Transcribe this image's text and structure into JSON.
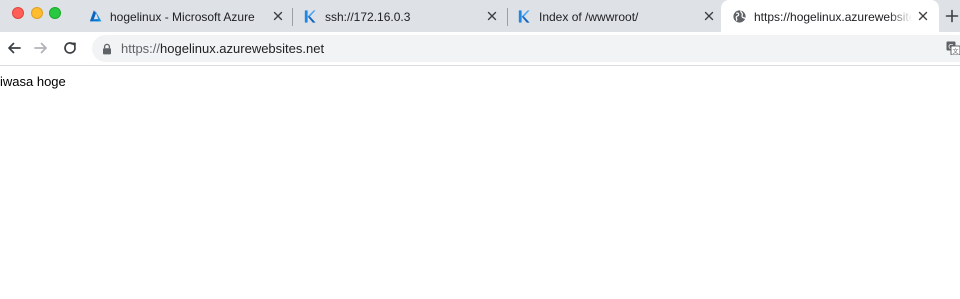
{
  "window": {
    "controls": [
      "close",
      "minimize",
      "zoom"
    ]
  },
  "tabs": [
    {
      "title": "hogelinux - Microsoft Azure",
      "icon": "azure-icon",
      "active": false
    },
    {
      "title": "ssh://172.16.0.3",
      "icon": "kudu-icon",
      "active": false
    },
    {
      "title": "Index of /wwwroot/",
      "icon": "kudu-icon",
      "active": false
    },
    {
      "title": "https://hogelinux.azurewebsites.net",
      "icon": "globe-icon",
      "active": true
    }
  ],
  "toolbar": {
    "url_scheme": "https://",
    "url_host": "hogelinux.azurewebsites.net"
  },
  "page": {
    "body_text": "iwasa hoge"
  },
  "colors": {
    "tabstrip_bg": "#dee1e6",
    "omnibox_bg": "#f1f3f4",
    "azure_blue": "#0078d4",
    "kudu_blue": "#1e88e5"
  }
}
